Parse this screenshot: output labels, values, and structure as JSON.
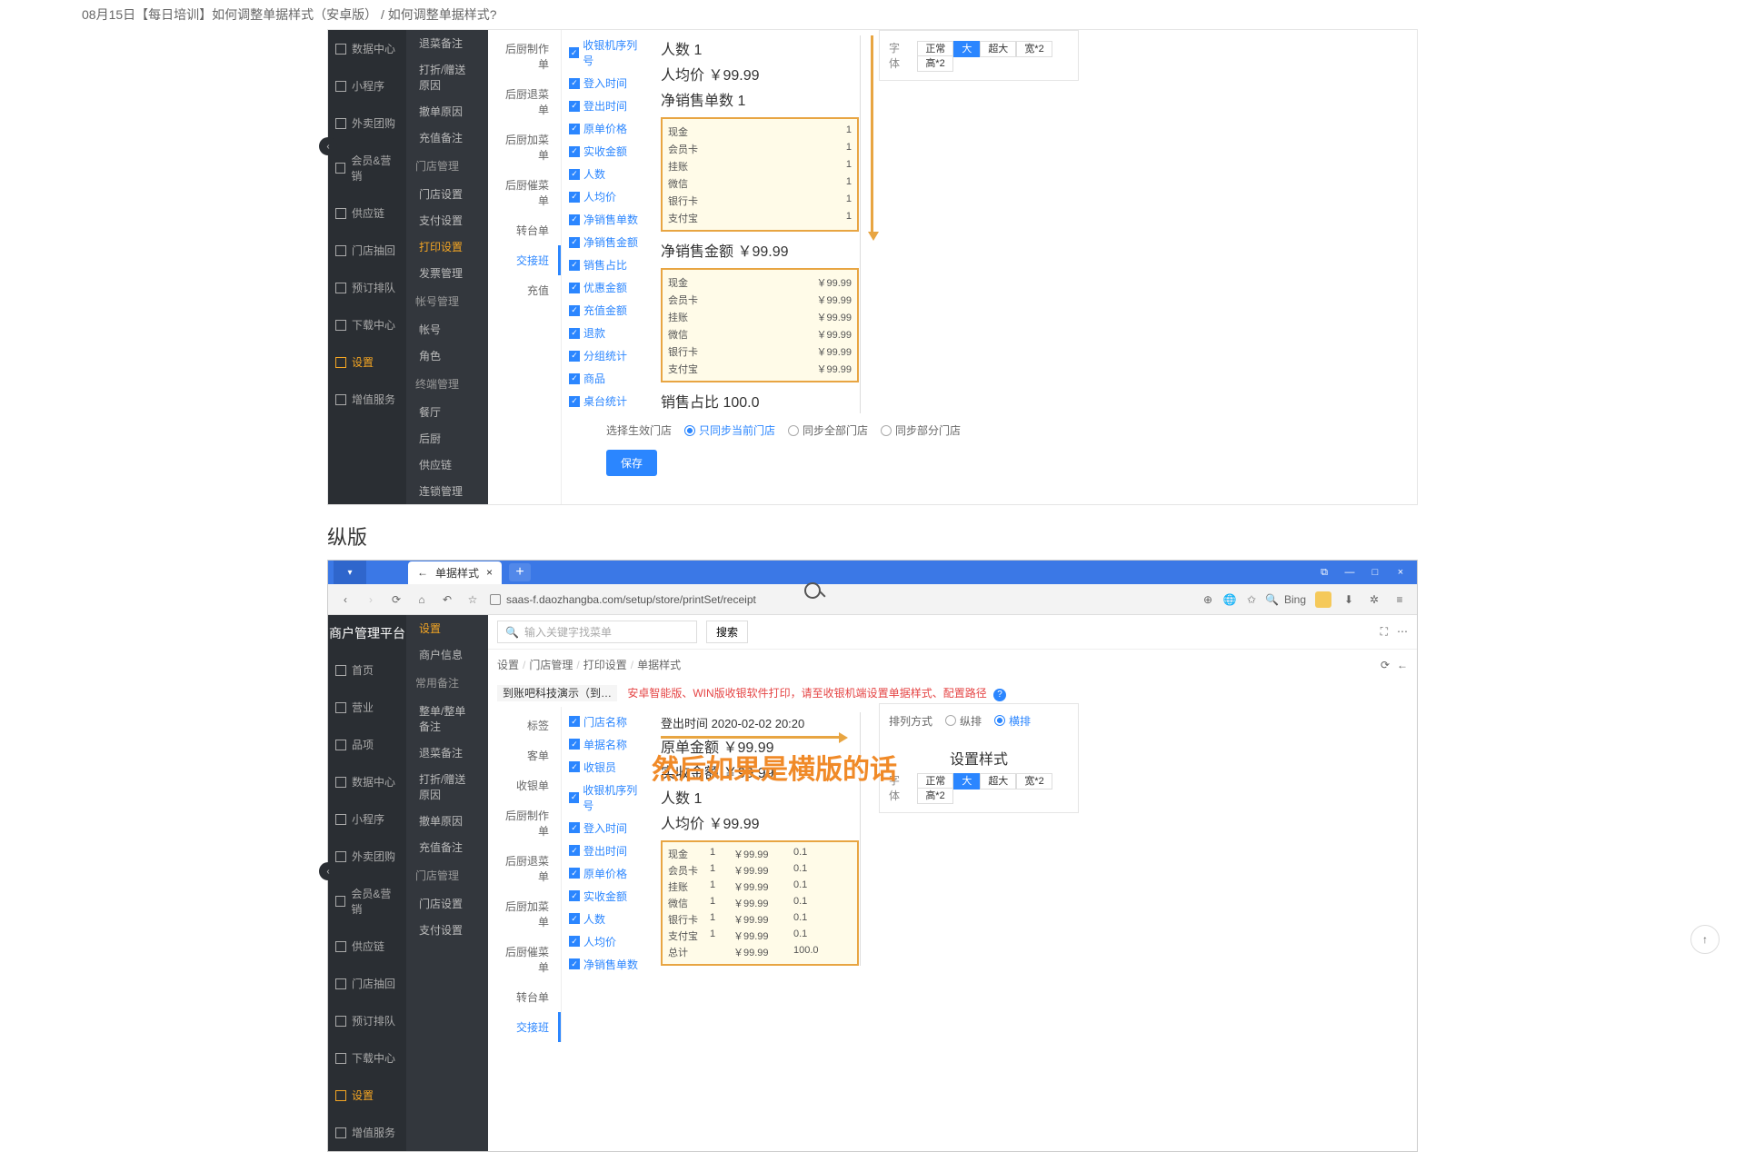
{
  "page_title": "08月15日【每日培训】如何调整单据样式（安卓版） / 如何调整单据样式?",
  "section2_title": "纵版",
  "sidebar1": {
    "items": [
      {
        "label": "数据中心",
        "name": "data-center"
      },
      {
        "label": "小程序",
        "name": "miniapp"
      },
      {
        "label": "外卖团购",
        "name": "delivery"
      },
      {
        "label": "会员&营销",
        "name": "member"
      },
      {
        "label": "供应链",
        "name": "supply"
      },
      {
        "label": "门店抽回",
        "name": "store-recall"
      },
      {
        "label": "预订排队",
        "name": "reserve"
      },
      {
        "label": "下载中心",
        "name": "download"
      },
      {
        "label": "设置",
        "name": "settings",
        "active": true
      },
      {
        "label": "增值服务",
        "name": "valueadd"
      }
    ],
    "items2_prefix": [
      {
        "label": "首页",
        "name": "home"
      },
      {
        "label": "营业",
        "name": "operate"
      },
      {
        "label": "品项",
        "name": "items"
      }
    ]
  },
  "sidebar2": {
    "top": [
      {
        "label": "退菜备注"
      },
      {
        "label": "打折/赠送原因"
      },
      {
        "label": "撤单原因"
      },
      {
        "label": "充值备注"
      }
    ],
    "group1_title": "门店管理",
    "group1": [
      {
        "label": "门店设置"
      },
      {
        "label": "支付设置"
      },
      {
        "label": "打印设置",
        "active": true
      },
      {
        "label": "发票管理"
      }
    ],
    "group2_title": "帐号管理",
    "group2": [
      {
        "label": "帐号"
      },
      {
        "label": "角色"
      }
    ],
    "group3_title": "终端管理",
    "group3": [
      {
        "label": "餐厅"
      },
      {
        "label": "后厨"
      },
      {
        "label": "供应链"
      },
      {
        "label": "连锁管理"
      }
    ],
    "block2_top_title": "设置",
    "block2_items": [
      {
        "label": "商户信息"
      },
      {
        "label": "常用备注",
        "group": true
      },
      {
        "label": "整单/整单备注"
      },
      {
        "label": "退菜备注"
      },
      {
        "label": "打折/赠送原因"
      },
      {
        "label": "撤单原因"
      },
      {
        "label": "充值备注"
      },
      {
        "label": "门店管理",
        "group": true
      },
      {
        "label": "门店设置"
      },
      {
        "label": "支付设置"
      }
    ]
  },
  "col3": {
    "items": [
      {
        "label": "后厨制作单"
      },
      {
        "label": "后厨退菜单"
      },
      {
        "label": "后厨加菜单"
      },
      {
        "label": "后厨催菜单"
      },
      {
        "label": "转台单"
      },
      {
        "label": "交接班",
        "active": true
      },
      {
        "label": "充值"
      }
    ],
    "items2": [
      {
        "label": "标签"
      },
      {
        "label": "客单"
      },
      {
        "label": "收银单"
      },
      {
        "label": "后厨制作单"
      },
      {
        "label": "后厨退菜单"
      },
      {
        "label": "后厨加菜单"
      },
      {
        "label": "后厨催菜单"
      },
      {
        "label": "转台单"
      },
      {
        "label": "交接班",
        "active": true
      }
    ]
  },
  "col4": {
    "items": [
      {
        "label": "收银机序列号"
      },
      {
        "label": "登入时间"
      },
      {
        "label": "登出时间"
      },
      {
        "label": "原单价格"
      },
      {
        "label": "实收金额"
      },
      {
        "label": "人数"
      },
      {
        "label": "人均价"
      },
      {
        "label": "净销售单数"
      },
      {
        "label": "净销售金额"
      },
      {
        "label": "销售占比"
      },
      {
        "label": "优惠金额"
      },
      {
        "label": "充值金额"
      },
      {
        "label": "退款"
      },
      {
        "label": "分组统计"
      },
      {
        "label": "商品"
      },
      {
        "label": "桌台统计"
      }
    ],
    "items2": [
      {
        "label": "门店名称"
      },
      {
        "label": "单据名称"
      },
      {
        "label": "收银员"
      },
      {
        "label": "收银机序列号"
      },
      {
        "label": "登入时间"
      },
      {
        "label": "登出时间"
      },
      {
        "label": "原单价格"
      },
      {
        "label": "实收金额"
      },
      {
        "label": "人数"
      },
      {
        "label": "人均价"
      },
      {
        "label": "净销售单数"
      }
    ]
  },
  "receipt1": {
    "people": "人数 1",
    "avg": "人均价 ￥99.99",
    "net_count": "净销售单数 1",
    "pay_count": [
      {
        "name": "现金",
        "v": "1"
      },
      {
        "name": "会员卡",
        "v": "1"
      },
      {
        "name": "挂账",
        "v": "1"
      },
      {
        "name": "微信",
        "v": "1"
      },
      {
        "name": "银行卡",
        "v": "1"
      },
      {
        "name": "支付宝",
        "v": "1"
      }
    ],
    "net_amount": "净销售金额 ￥99.99",
    "pay_amount": [
      {
        "name": "现金",
        "v": "￥99.99"
      },
      {
        "name": "会员卡",
        "v": "￥99.99"
      },
      {
        "name": "挂账",
        "v": "￥99.99"
      },
      {
        "name": "微信",
        "v": "￥99.99"
      },
      {
        "name": "银行卡",
        "v": "￥99.99"
      },
      {
        "name": "支付宝",
        "v": "￥99.99"
      }
    ],
    "ratio": "销售占比 100.0"
  },
  "font_panel": {
    "label": "字体",
    "opts": [
      "正常",
      "大",
      "超大",
      "宽*2",
      "高*2"
    ],
    "active_index": 1
  },
  "footer": {
    "label": "选择生效门店",
    "opts": [
      "只同步当前门店",
      "同步全部门店",
      "同步部分门店"
    ],
    "active": 0,
    "save": "保存"
  },
  "browser": {
    "tab_title": "单据样式",
    "url": "saas-f.daozhangba.com/setup/store/printSet/receipt",
    "search_engine": "Bing",
    "brand": "商户管理平台",
    "search_placeholder": "输入关键字找菜单",
    "search_btn": "搜索",
    "breadcrumb": [
      "设置",
      "门店管理",
      "打印设置",
      "单据样式"
    ],
    "warn_tag": "到账吧科技演示（到…",
    "warn_text": "安卓智能版、WIN版收银软件打印，请至收银机端设置单据样式、配置路径"
  },
  "receipt2": {
    "logout": "登出时间 2020-02-02 20:20",
    "orig": "原单金额 ￥99.99",
    "real": "实收金额 ￥99.99",
    "people": "人数 1",
    "avg": "人均价 ￥99.99",
    "horiz": [
      {
        "name": "现金",
        "c": "1",
        "a": "￥99.99",
        "r": "0.1"
      },
      {
        "name": "会员卡",
        "c": "1",
        "a": "￥99.99",
        "r": "0.1"
      },
      {
        "name": "挂账",
        "c": "1",
        "a": "￥99.99",
        "r": "0.1"
      },
      {
        "name": "微信",
        "c": "1",
        "a": "￥99.99",
        "r": "0.1"
      },
      {
        "name": "银行卡",
        "c": "1",
        "a": "￥99.99",
        "r": "0.1"
      },
      {
        "name": "支付宝",
        "c": "1",
        "a": "￥99.99",
        "r": "0.1"
      },
      {
        "name": "总计",
        "c": "",
        "a": "￥99.99",
        "r": "100.0"
      }
    ]
  },
  "layout_panel": {
    "label": "排列方式",
    "opts": [
      "纵排",
      "横排"
    ],
    "active": 1,
    "style_title": "设置样式"
  },
  "caption": "然后如果是横版的话"
}
